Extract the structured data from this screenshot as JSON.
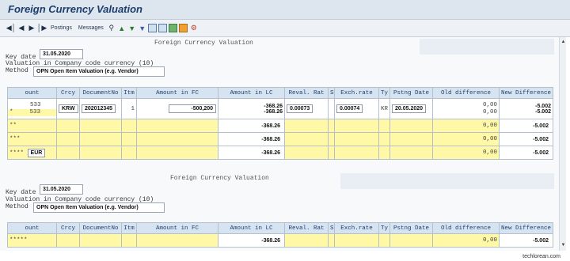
{
  "title": "Foreign Currency Valuation",
  "toolbar": {
    "postings": "Postings",
    "messages": "Messages"
  },
  "section1": {
    "heading": "Foreign Currency Valuation",
    "key_date_label": "Key date",
    "key_date": "31.05.2020",
    "valuation_text": "Valuation in Company code currency (10)",
    "method_label": "Method",
    "method": "OPN Open Item Valuation (e.g. Vendor)",
    "headers": [
      "ount",
      "Crcy",
      "DocumentNo",
      "Itm",
      "Amount in FC",
      "Amount in LC",
      "Reval. Rat",
      "S",
      "Exch.rate",
      "Ty",
      "Pstng Date",
      "Old difference",
      "New Difference"
    ],
    "row1": {
      "account1": "533",
      "account2": "533",
      "mark": "*",
      "crcy": "KRW",
      "doc": "202012345",
      "itm": "1",
      "amount_fc": "-500,200",
      "amount_lc1": "-368.26",
      "amount_lc2": "-368.26",
      "reval": "0.00073",
      "exch": "0.00074",
      "ty": "KR",
      "pstng": "20.05.2020",
      "old1": "0,00",
      "old2": "0,00",
      "new1": "-5.002",
      "new2": "-5.002"
    },
    "row2": {
      "mark": "**",
      "amount_lc": "-368.26",
      "old": "0,00",
      "new": "-5.002"
    },
    "row3": {
      "mark": "***",
      "amount_lc": "-368.26",
      "old": "0,00",
      "new": "-5.002"
    },
    "row4": {
      "mark": "****",
      "crcy": "EUR",
      "amount_lc": "-368.26",
      "old": "0,00",
      "new": "-5.002"
    }
  },
  "section2": {
    "heading": "Foreign Currency Valuation",
    "key_date_label": "Key date",
    "key_date": "31.05.2020",
    "valuation_text": "Valuation in Company code currency (10)",
    "method_label": "Method",
    "method": "OPN Open Item Valuation (e.g. Vendor)",
    "headers": [
      "ount",
      "Crcy",
      "DocumentNo",
      "Itm",
      "Amount in FC",
      "Amount in LC",
      "Reval. Rat",
      "S",
      "Exch.rate",
      "Ty",
      "Pstng Date",
      "Old difference",
      "New Difference"
    ],
    "row1": {
      "mark": "*****",
      "amount_lc": "-368.26",
      "old": "0,00",
      "new": "-5.002"
    }
  },
  "watermark": "techlorean.com"
}
